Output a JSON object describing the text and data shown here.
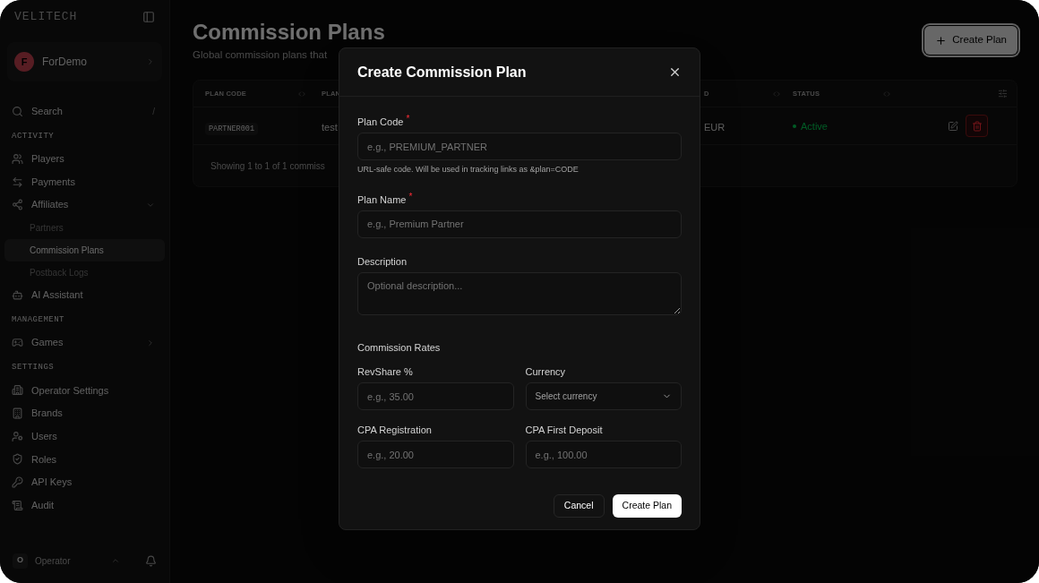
{
  "sidebar": {
    "brand": "VELITECH",
    "org": {
      "initial": "F",
      "name": "ForDemo"
    },
    "search": {
      "label": "Search",
      "shortcut": "/"
    },
    "sections": [
      {
        "items": [
          {
            "label": "Players",
            "selected": false
          },
          {
            "label": "Payments",
            "selected": false
          },
          {
            "label": "Affiliates",
            "selected": false,
            "expanded": true,
            "children": [
              {
                "label": "Partners",
                "selected": false
              },
              {
                "label": "Commission Plans",
                "selected": true
              },
              {
                "label": "Postback Logs",
                "selected": false
              }
            ]
          },
          {
            "label": "AI Assistant",
            "selected": false
          }
        ],
        "title": "ACTIVITY"
      },
      {
        "title": "MANAGEMENT",
        "items": [
          {
            "label": "Games",
            "selected": false,
            "expanded": false
          }
        ]
      },
      {
        "title": "SETTINGS",
        "items": [
          {
            "label": "Operator Settings",
            "selected": false
          },
          {
            "label": "Brands",
            "selected": false
          },
          {
            "label": "Users",
            "selected": false
          },
          {
            "label": "Roles",
            "selected": false
          },
          {
            "label": "API Keys",
            "selected": false
          },
          {
            "label": "Audit",
            "selected": false
          }
        ]
      }
    ],
    "user": {
      "initial": "O",
      "name": "Operator"
    }
  },
  "page": {
    "title": "Commission Plans",
    "subtitle": "Global commission plans that",
    "create_button": "Create Plan",
    "table": {
      "columns": [
        "PLAN CODE",
        "PLAN",
        "D",
        "STATUS"
      ],
      "rows": [
        {
          "code": "PARTNER001",
          "column_2": "test",
          "column_3": "EUR",
          "status": "Active"
        }
      ],
      "footer": "Showing 1 to 1 of 1 commiss"
    }
  },
  "dialog": {
    "title": "Create Commission Plan",
    "required_mark": "*",
    "fields": [
      {
        "kind": "text",
        "label": "Plan Code",
        "required": true,
        "placeholder": "e.g., PREMIUM_PARTNER",
        "hint": "URL-safe code. Will be used in tracking links as &plan=CODE"
      },
      {
        "kind": "text",
        "label": "Plan Name",
        "required": true,
        "placeholder": "e.g., Premium Partner"
      },
      {
        "kind": "textarea",
        "label": "Description",
        "required": false,
        "placeholder": "Optional description..."
      }
    ],
    "rates_title": "Commission Rates",
    "rates": [
      {
        "kind": "text",
        "label": "RevShare %",
        "placeholder": "e.g., 35.00"
      },
      {
        "kind": "select",
        "label": "Currency",
        "placeholder": "Select currency"
      },
      {
        "kind": "text",
        "label": "CPA Registration",
        "placeholder": "e.g., 20.00"
      },
      {
        "kind": "text",
        "label": "CPA First Deposit",
        "placeholder": "e.g., 100.00"
      }
    ],
    "buttons": {
      "cancel": "Cancel",
      "submit": "Create Plan"
    }
  }
}
